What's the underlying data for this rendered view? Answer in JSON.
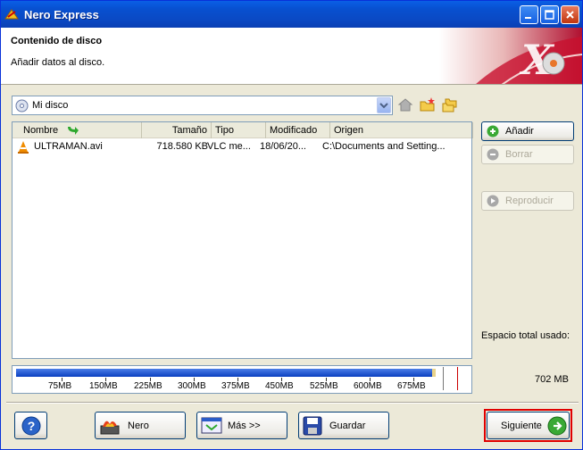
{
  "window": {
    "title": "Nero Express"
  },
  "header": {
    "title": "Contenido de disco",
    "subtitle": "Añadir datos al disco."
  },
  "disc_selector": {
    "value": "Mi disco"
  },
  "file_list": {
    "columns": [
      "Nombre",
      "Tamaño",
      "Tipo",
      "Modificado",
      "Origen"
    ],
    "rows": [
      {
        "name": "ULTRAMAN.avi",
        "size": "718.580 KB",
        "type": "VLC me...",
        "modified": "18/06/20...",
        "origin": "C:\\Documents and Setting..."
      }
    ]
  },
  "side_buttons": {
    "add": "Añadir",
    "delete": "Borrar",
    "play": "Reproducir"
  },
  "space": {
    "label": "Espacio total usado:",
    "value": "702 MB",
    "used_mb": 702
  },
  "gauge": {
    "ticks": [
      "75MB",
      "150MB",
      "225MB",
      "300MB",
      "375MB",
      "450MB",
      "525MB",
      "600MB",
      "675MB"
    ]
  },
  "bottom": {
    "nero": "Nero",
    "more": "Más >>",
    "save": "Guardar",
    "next": "Siguiente"
  },
  "colors": {
    "titlebar": "#0a5fe6",
    "accent_red": "#c8102e",
    "highlight_box": "#e00000"
  }
}
